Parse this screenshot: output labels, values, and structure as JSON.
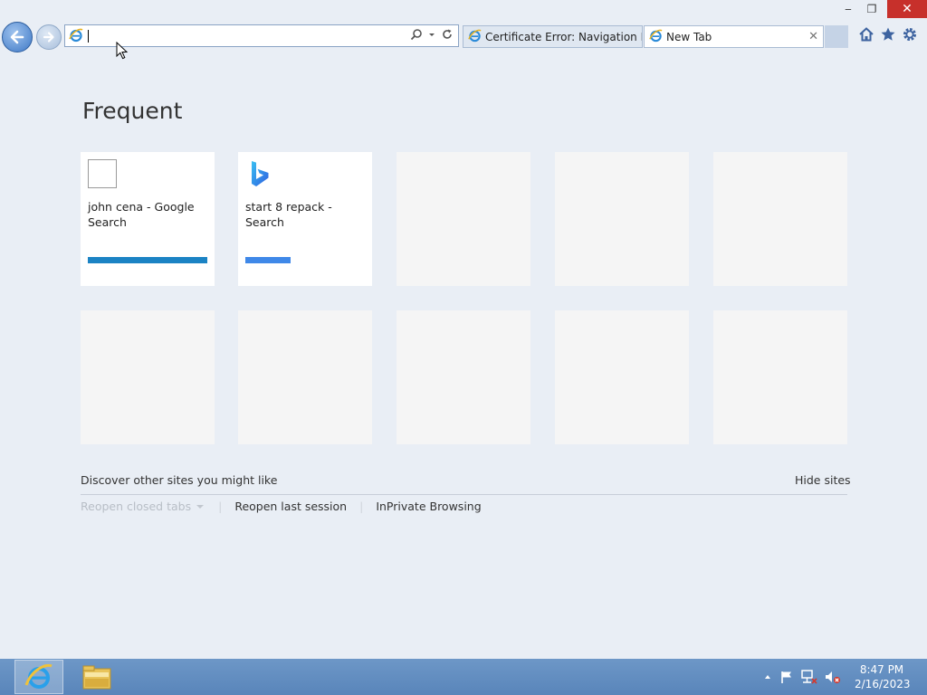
{
  "window": {
    "minimize_glyph": "‒",
    "restore_glyph": "❐",
    "close_glyph": "✕"
  },
  "address_bar": {
    "value": "",
    "placeholder": ""
  },
  "tabs": [
    {
      "label": "Certificate Error: Navigation Bl...",
      "active": false
    },
    {
      "label": "New Tab",
      "active": true,
      "close_glyph": "✕"
    }
  ],
  "toolbar_icons": [
    "home-icon",
    "favorites-star-icon",
    "tools-gear-icon"
  ],
  "page": {
    "section_title": "Frequent",
    "tiles": [
      {
        "label": "john cena - Google Search",
        "icon": "blank-favicon-icon",
        "bar_color": "#1b83c4",
        "bar_fraction": 1.0
      },
      {
        "label": "start 8 repack - Search",
        "icon": "bing-logo-icon",
        "bar_color": "#3f88e8",
        "bar_fraction": 0.38
      },
      {
        "label": ""
      },
      {
        "label": ""
      },
      {
        "label": ""
      },
      {
        "label": ""
      },
      {
        "label": ""
      },
      {
        "label": ""
      },
      {
        "label": ""
      },
      {
        "label": ""
      }
    ],
    "discover_text": "Discover other sites you might like",
    "hide_sites": "Hide sites",
    "reopen_closed_tabs": "Reopen closed tabs",
    "reopen_last_session": "Reopen last session",
    "inprivate": "InPrivate Browsing"
  },
  "taskbar": {
    "apps": [
      "internet-explorer-icon",
      "file-explorer-icon"
    ],
    "tray_icons": [
      "show-hidden-icons-arrow",
      "action-center-flag-icon",
      "network-icon",
      "volume-muted-icon"
    ],
    "time": "8:47 PM",
    "date": "2/16/2023"
  },
  "colors": {
    "accent": "#3e78c6",
    "close_button": "#c7302b",
    "taskbar": "#6390c2",
    "background": "#e9eef5"
  }
}
